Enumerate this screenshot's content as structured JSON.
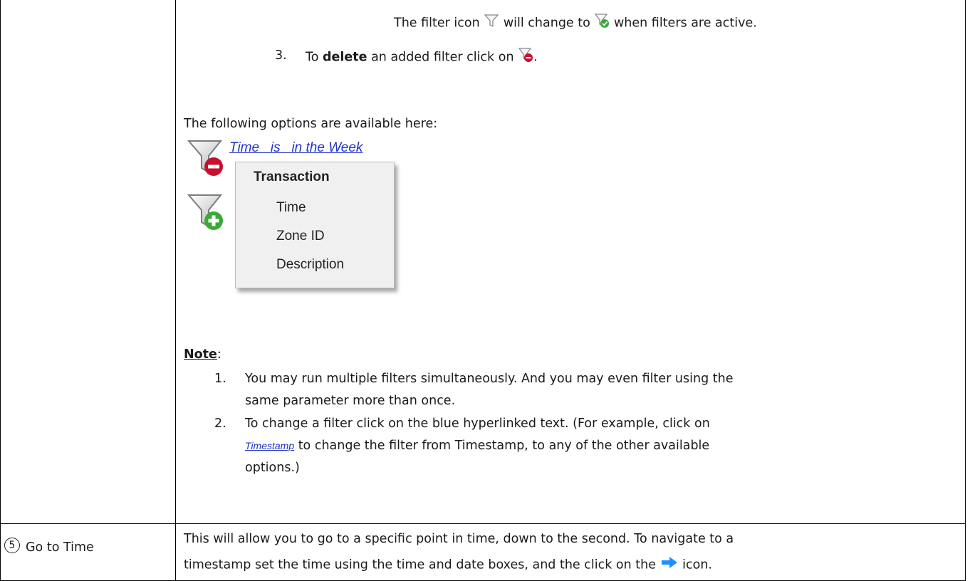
{
  "section_filters": {
    "line1_pre": "The filter icon",
    "line1_mid": "will change to",
    "line1_post": "when filters are active.",
    "step3_num": "3.",
    "step3_pre": "To ",
    "step3_bold": "delete",
    "step3_post": " an added filter click on",
    "step3_end": ".",
    "options_intro": "The following options are available here:",
    "filter_link": "Time   is   in the Week",
    "menu": {
      "header": "Transaction",
      "items": [
        "Time",
        "Zone ID",
        "Description"
      ]
    },
    "note_label": "Note",
    "note_colon": ":",
    "notes": [
      {
        "num": "1.",
        "line1": "You may run multiple filters simultaneously. And you may even filter using the",
        "line2": "same parameter more than once."
      },
      {
        "num": "2.",
        "line1": "To change a filter click on the blue hyperlinked text. (For example, click on",
        "link": "Timestamp",
        "line2_post": " to change the filter from Timestamp, to any of the other available",
        "line3": "options.)"
      }
    ]
  },
  "row_goto": {
    "number": "5",
    "label": "Go to Time",
    "line1": "This will allow you to go to a specific point in time, down to the second. To navigate to a",
    "line2_pre": "timestamp set the time using the time and date boxes, and the click on the",
    "line2_post": " icon."
  },
  "icons": {
    "filter": "filter-icon",
    "filter_active": "filter-active-icon",
    "filter_delete": "filter-delete-icon",
    "filter_add": "filter-add-icon",
    "arrow": "arrow-right-icon"
  },
  "colors": {
    "link": "#2233cc",
    "delete_badge": "#c8102e",
    "add_badge": "#3aa935",
    "arrow": "#1e90ff"
  }
}
